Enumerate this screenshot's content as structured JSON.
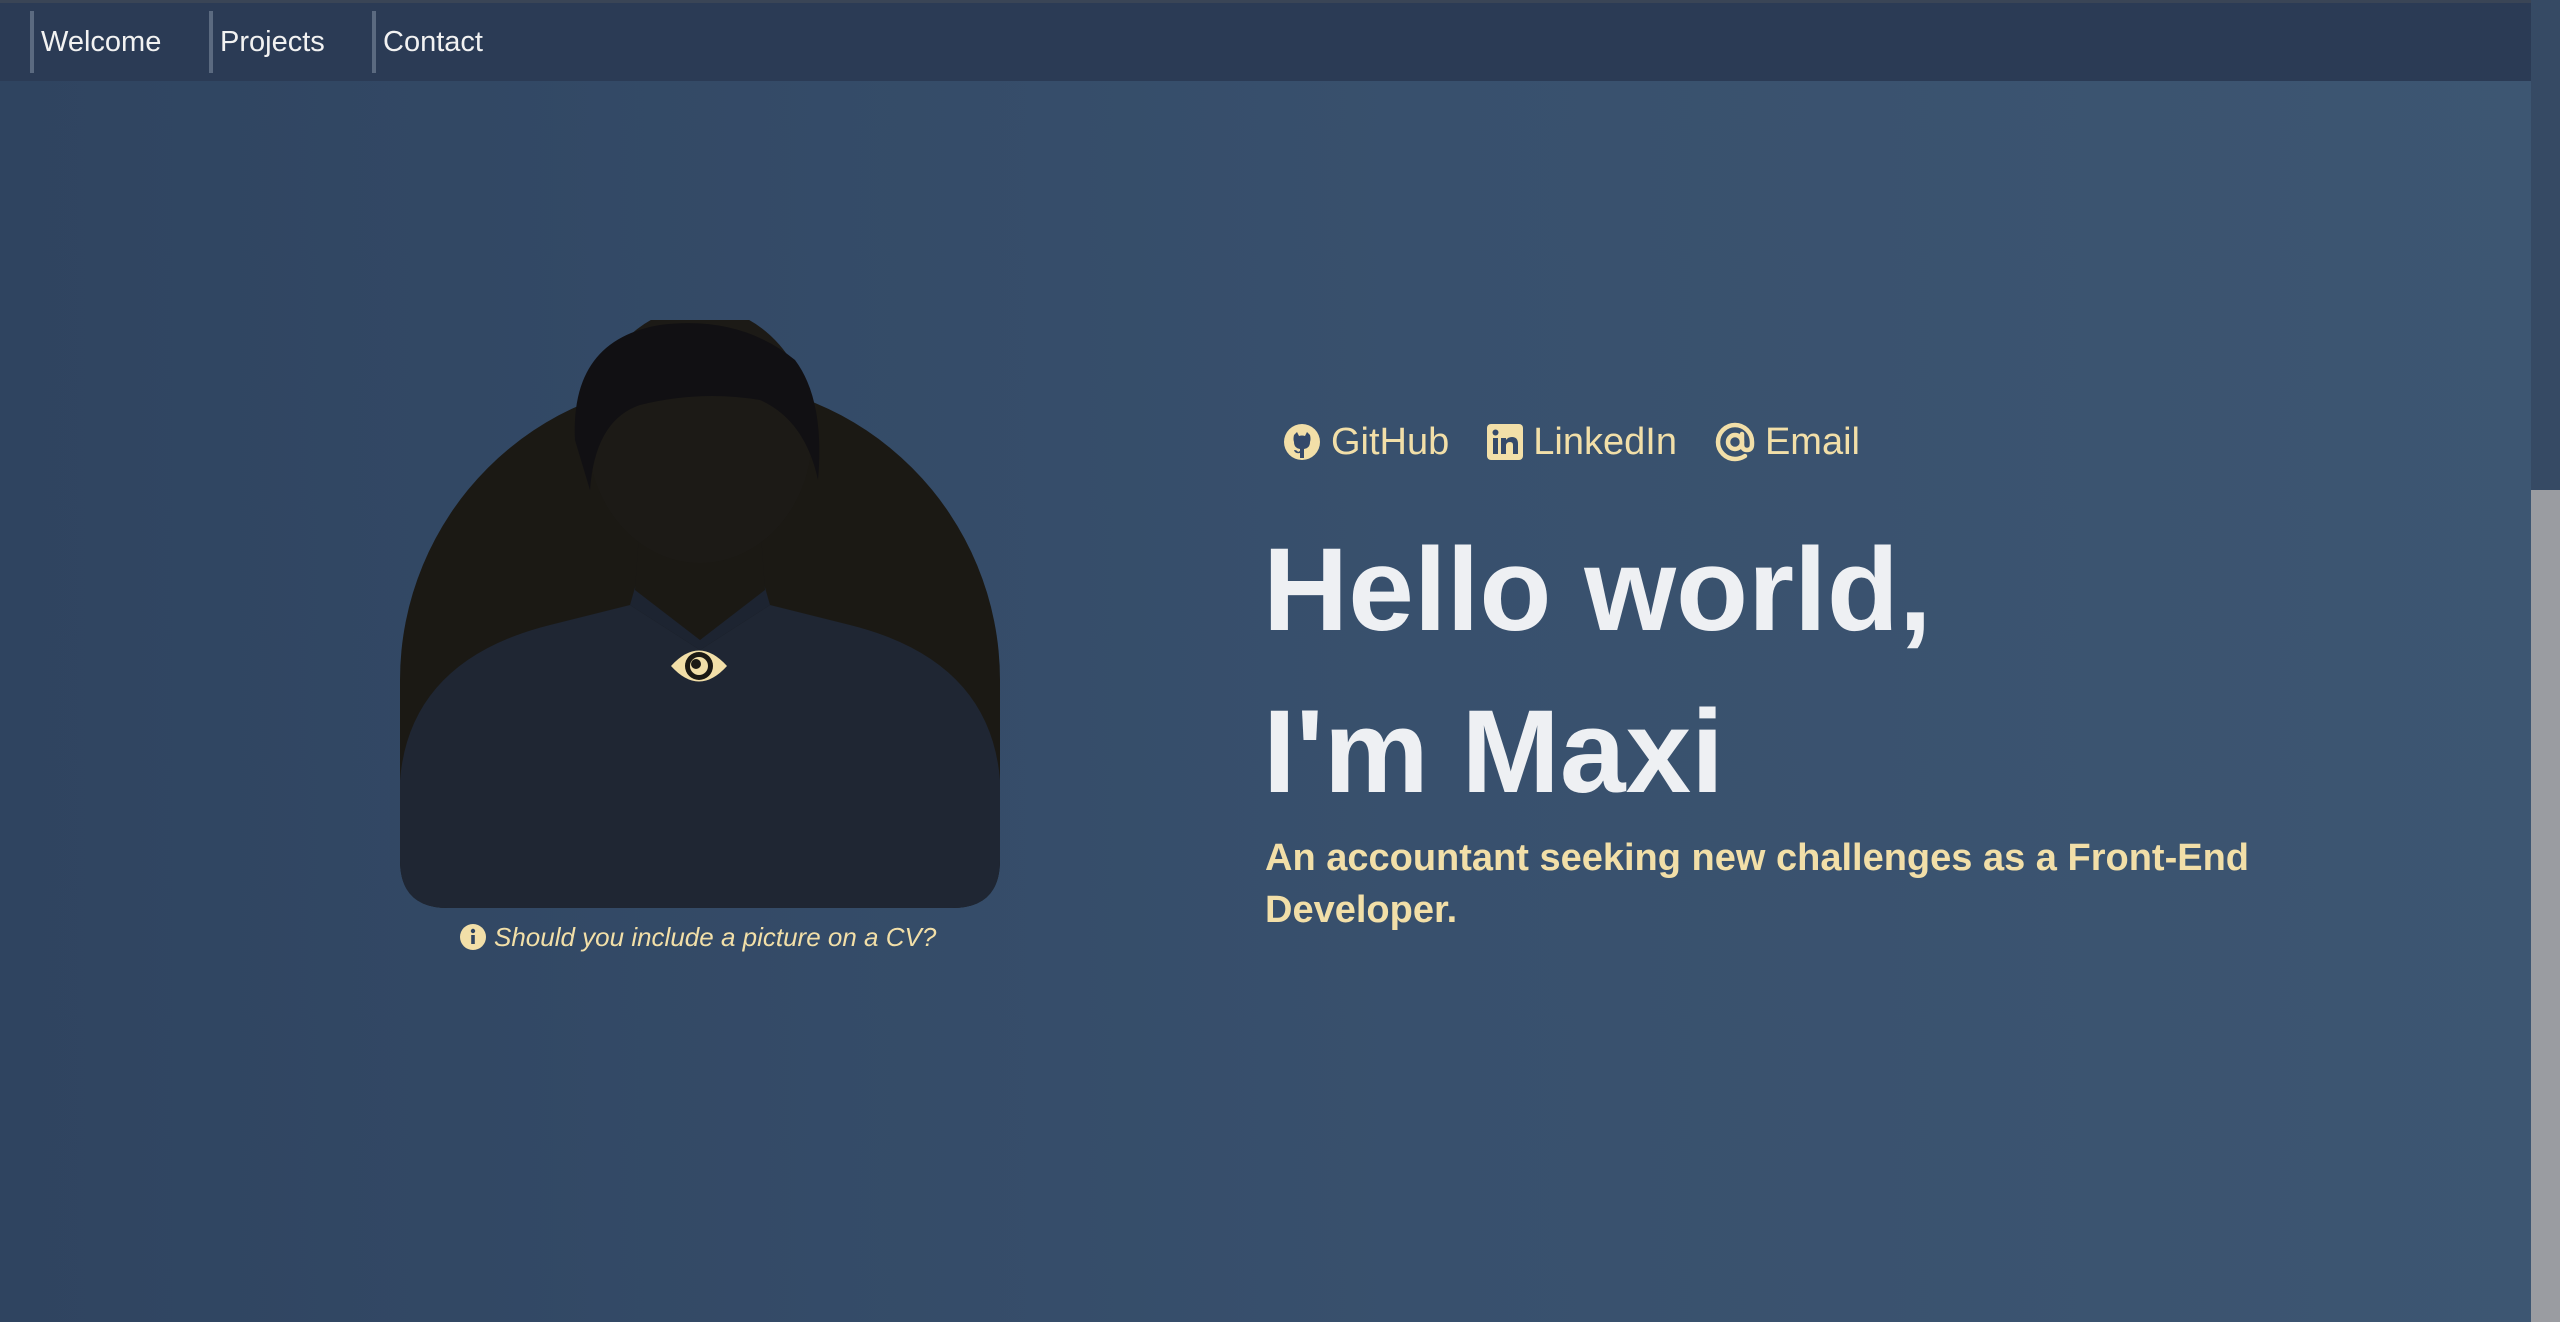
{
  "nav": {
    "items": [
      "Welcome",
      "Projects",
      "Contact"
    ]
  },
  "profile": {
    "caption": "Should you include a picture on a CV?"
  },
  "links": {
    "github": "GitHub",
    "linkedin": "LinkedIn",
    "email": "Email"
  },
  "hero": {
    "line1": "Hello world,",
    "line2": "I'm Maxi",
    "subtitle": "An accountant seeking new challenges as a Front-End Developer."
  },
  "colors": {
    "background": "#38506d",
    "topbar": "#2b3b55",
    "accent": "#f2dfa8",
    "heading": "#eef0f3"
  },
  "icons": {
    "photo_overlay": "eye-icon",
    "caption": "info-icon",
    "github": "github-icon",
    "linkedin": "linkedin-icon",
    "email": "at-sign-icon"
  }
}
